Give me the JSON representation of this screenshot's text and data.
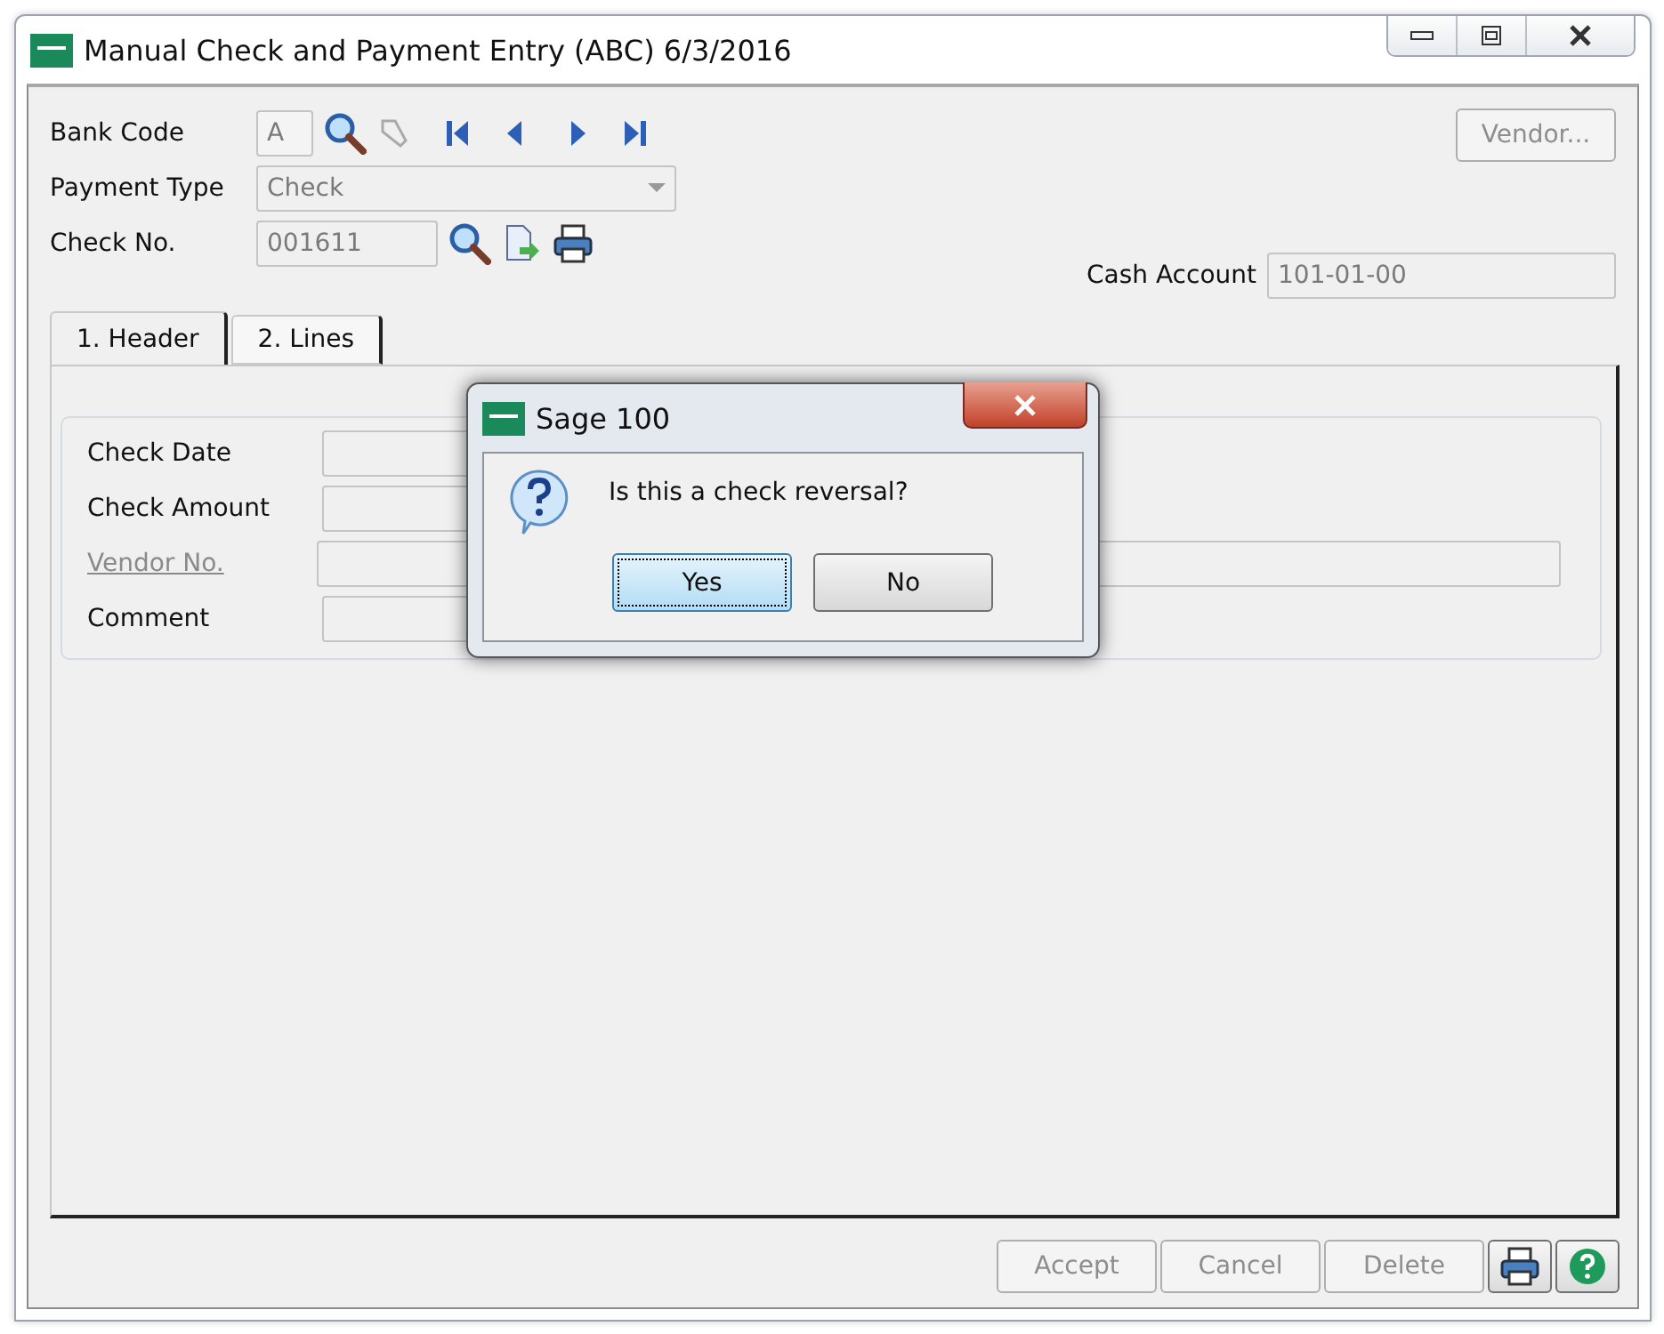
{
  "window": {
    "title": "Manual Check and Payment Entry (ABC) 6/3/2016"
  },
  "bank_code": {
    "label": "Bank Code",
    "value": "A"
  },
  "payment_type": {
    "label": "Payment Type",
    "value": "Check",
    "disabled": true
  },
  "check_no": {
    "label": "Check No.",
    "value": "001611"
  },
  "vendor_button": {
    "label": "Vendor...",
    "disabled": true
  },
  "cash_account": {
    "label": "Cash Account",
    "value": "101-01-00"
  },
  "tabs": [
    {
      "label": "1. Header",
      "selected": true
    },
    {
      "label": "2. Lines",
      "selected": false
    }
  ],
  "header_fields": [
    {
      "label": "Check Date",
      "kind": "short"
    },
    {
      "label": "Check Amount",
      "kind": "short"
    },
    {
      "label": "Vendor No.",
      "kind": "link"
    },
    {
      "label": "Comment",
      "kind": "short"
    }
  ],
  "dialog": {
    "title": "Sage 100",
    "message": "Is this a check reversal?",
    "buttons": [
      {
        "label": "Yes",
        "selected": true
      },
      {
        "label": "No",
        "selected": false
      }
    ]
  },
  "footer_buttons": [
    {
      "label": "Accept",
      "disabled": true
    },
    {
      "label": "Cancel",
      "disabled": true
    },
    {
      "label": "Delete",
      "disabled": true
    }
  ]
}
